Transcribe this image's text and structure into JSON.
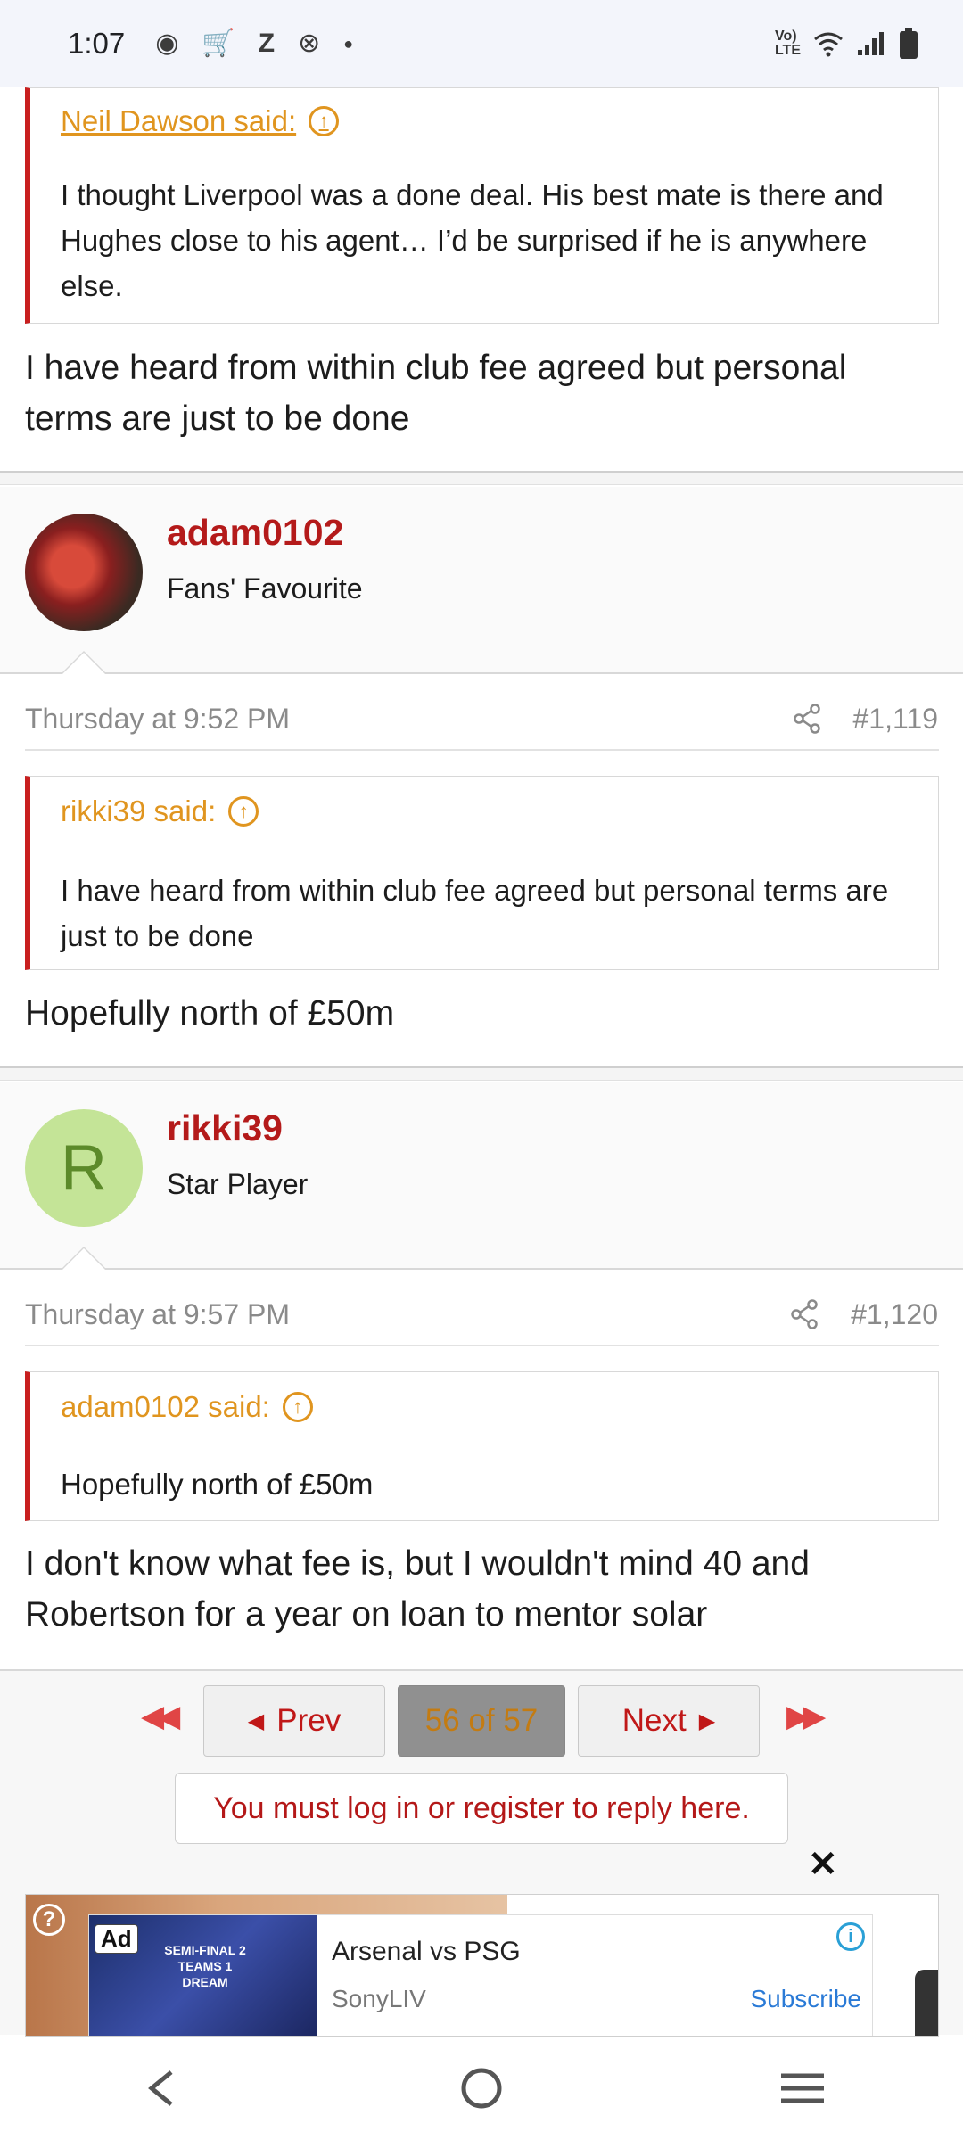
{
  "status_bar": {
    "time": "1:07",
    "left_icons": [
      "notification-dot-icon",
      "cart-icon",
      "z-icon",
      "app-icon",
      "dot-icon"
    ],
    "right_icons": [
      "volte-icon",
      "wifi-icon",
      "signal-icon",
      "battery-icon"
    ],
    "volte_label": "VoLTE"
  },
  "posts": [
    {
      "quote": {
        "author_label": "Neil Dawson said:",
        "text": "I thought Liverpool was a done deal. His best mate is there and Hughes close to his agent… I’d be surprised if he is anywhere else."
      },
      "message": "I have heard from within club fee agreed but personal terms are just to be done"
    },
    {
      "username": "adam0102",
      "user_title": "Fans' Favourite",
      "date": "Thursday at 9:52 PM",
      "post_number": "#1,119",
      "quote": {
        "author_label": "rikki39 said:",
        "text": "I have heard from within club fee agreed but personal terms are just to be done"
      },
      "message": "Hopefully north of £50m"
    },
    {
      "username": "rikki39",
      "avatar_letter": "R",
      "user_title": "Star Player",
      "date": "Thursday at 9:57 PM",
      "post_number": "#1,120",
      "quote": {
        "author_label": "adam0102 said:",
        "text": "Hopefully north of £50m"
      },
      "message": "I don't know what fee is, but I wouldn't mind 40 and Robertson for a year on loan to mentor solar"
    }
  ],
  "pagination": {
    "prev_label": "Prev",
    "current_label": "56 of 57",
    "next_label": "Next"
  },
  "login_prompt": "You must log in or register to reply here.",
  "ad": {
    "badge": "Ad",
    "title": "Arsenal vs PSG",
    "advertiser": "SonyLIV",
    "cta": "Subscribe",
    "thumb_text": "SEMI-FINAL 2 TEAMS 1 DREAM"
  },
  "colors": {
    "accent_red": "#b41a1a",
    "quote_author": "#e0951f",
    "quote_border": "#c81f1f"
  }
}
